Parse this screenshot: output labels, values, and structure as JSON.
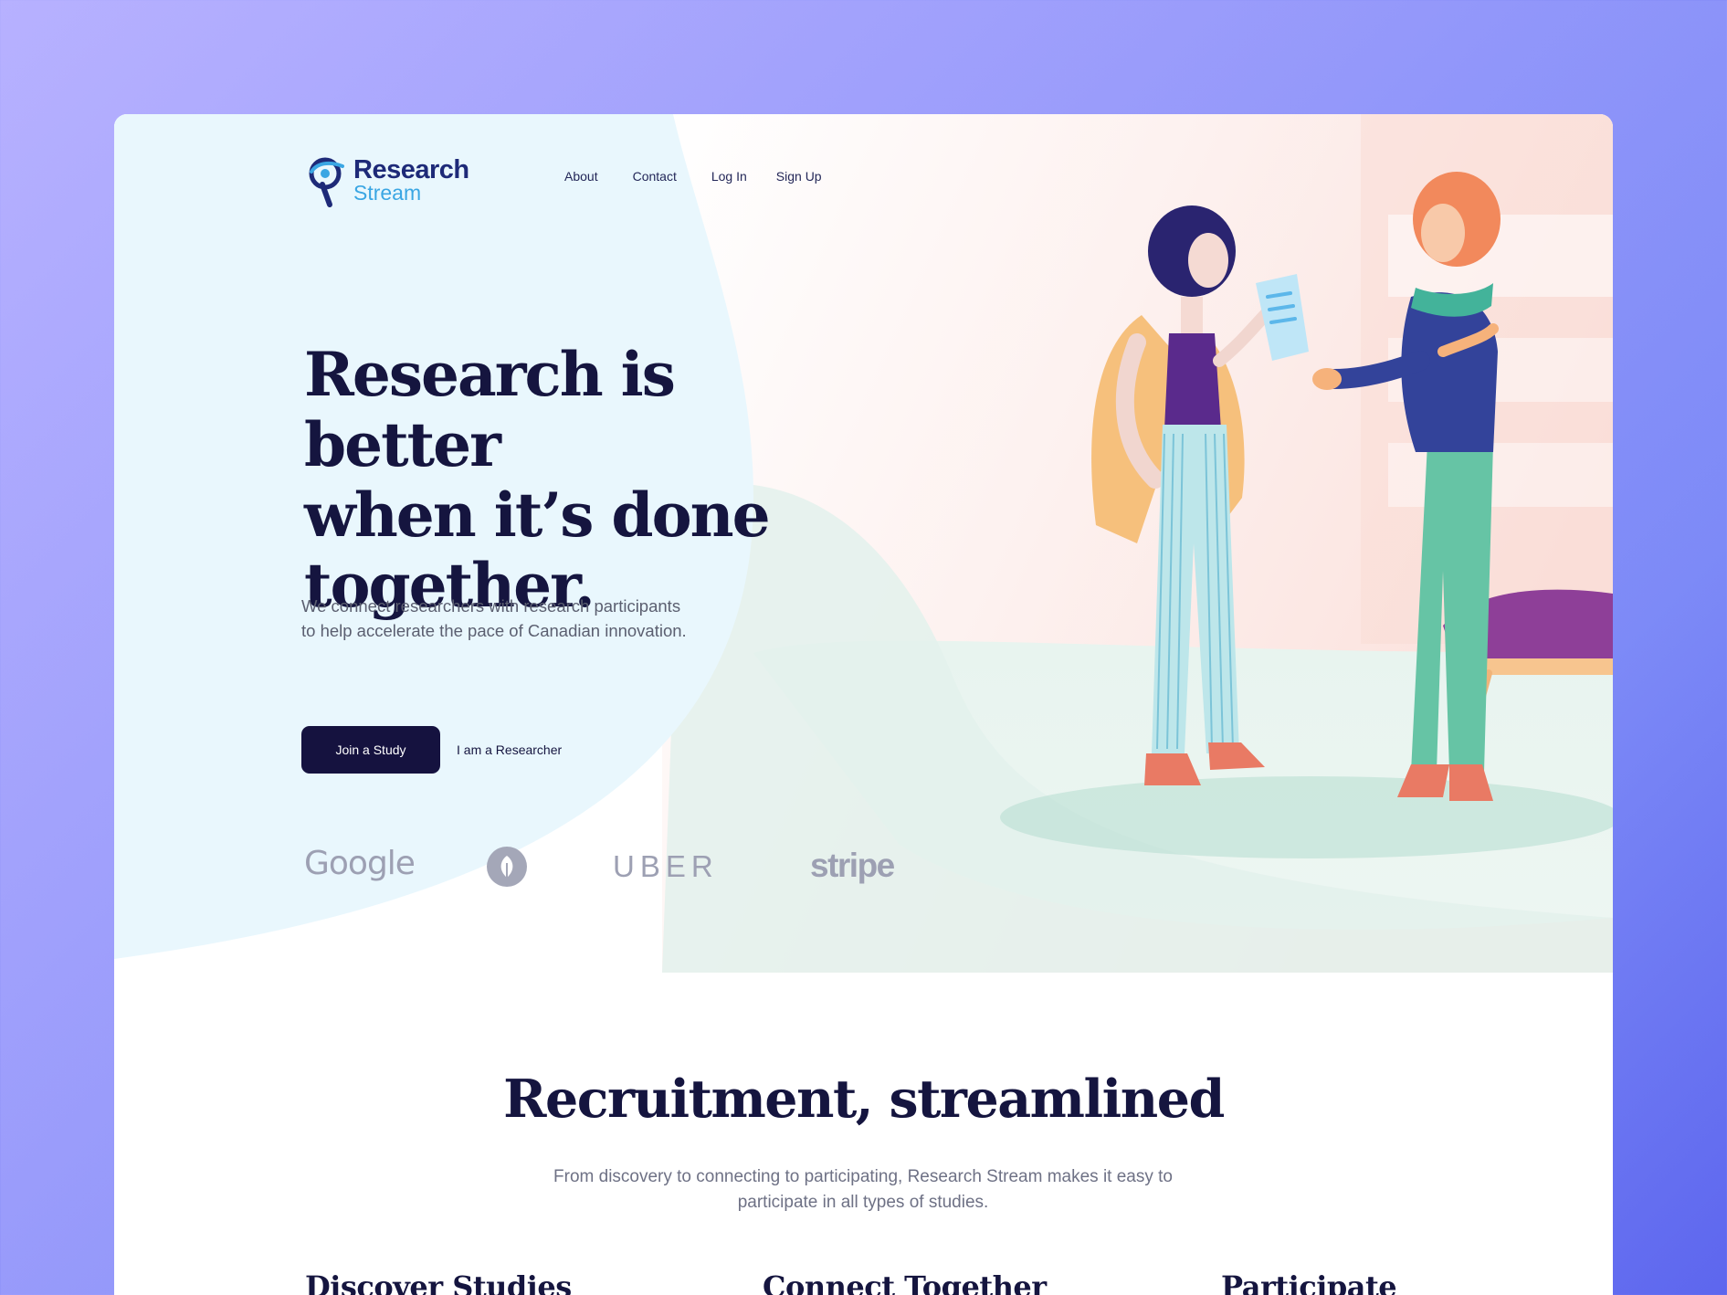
{
  "brand": {
    "line1": "Research",
    "line2": "Stream"
  },
  "nav": [
    "About",
    "Contact",
    "Log In",
    "Sign Up"
  ],
  "hero": {
    "headline_lines": [
      "Research is better",
      "when it’s done",
      "together."
    ],
    "subtitle": "We connect researchers with research participants to help accelerate the pace of Canadian innovation.",
    "primary_cta": "Join a Study",
    "secondary_cta": "I am a Researcher"
  },
  "partners": [
    "Google",
    "leaf-icon",
    "UBER",
    "stripe"
  ],
  "section": {
    "title": "Recruitment, streamlined",
    "subtitle": "From discovery to connecting to participating, Research Stream makes it easy to participate in all types of studies.",
    "features": [
      "Discover Studies",
      "Connect Together",
      "Participate"
    ]
  },
  "colors": {
    "background_gradient": [
      "#b7b1ff",
      "#5d66ee"
    ],
    "navy": "#15153f",
    "accent_blue": "#3aa6e3",
    "muted_text": "#5b5f70"
  }
}
